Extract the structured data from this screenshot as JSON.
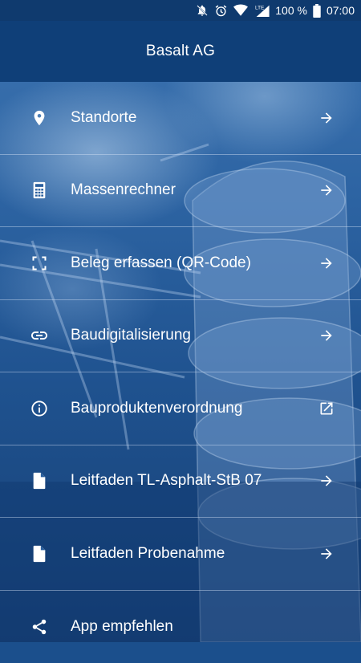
{
  "status_bar": {
    "battery": "100 %",
    "time": "07:00",
    "network": "LTE"
  },
  "app_bar": {
    "title": "Basalt AG"
  },
  "menu": {
    "items": [
      {
        "label": "Standorte",
        "icon": "location-pin-icon",
        "trailing_icon": "arrow-right-icon"
      },
      {
        "label": "Massenrechner",
        "icon": "calculator-icon",
        "trailing_icon": "arrow-right-icon"
      },
      {
        "label": "Beleg erfassen (QR-Code)",
        "icon": "scan-frame-icon",
        "trailing_icon": "arrow-right-icon"
      },
      {
        "label": "Baudigitalisierung",
        "icon": "link-icon",
        "trailing_icon": "arrow-right-icon"
      },
      {
        "label": "Bauproduktenverordnung",
        "icon": "info-icon",
        "trailing_icon": "open-external-icon"
      },
      {
        "label": "Leitfaden TL-Asphalt-StB 07",
        "icon": "document-icon",
        "trailing_icon": "arrow-right-icon"
      },
      {
        "label": "Leitfaden Probenahme",
        "icon": "document-icon",
        "trailing_icon": "arrow-right-icon"
      },
      {
        "label": "App empfehlen",
        "icon": "share-icon",
        "trailing_icon": ""
      }
    ]
  },
  "colors": {
    "status_bar": "#0f3a6e",
    "app_bar": "#0f3f78",
    "background": "#1b4f8c",
    "text": "#ffffff"
  }
}
